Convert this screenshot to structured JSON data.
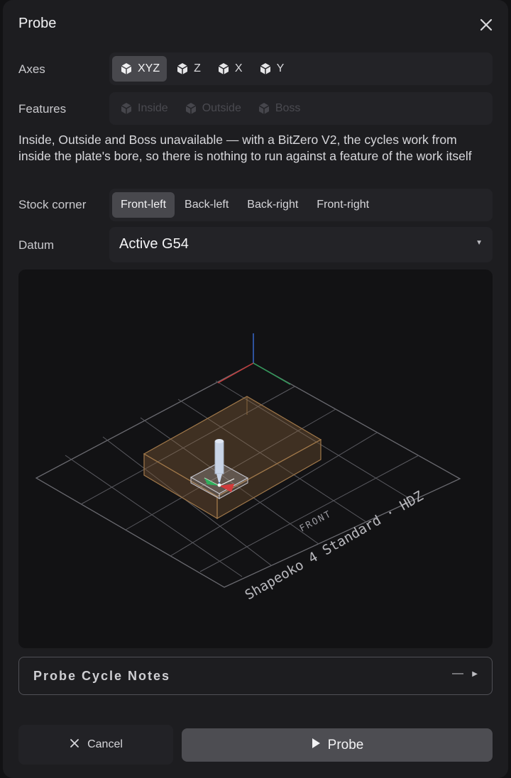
{
  "dialog": {
    "title": "Probe"
  },
  "axes": {
    "label": "Axes",
    "options": [
      "XYZ",
      "Z",
      "X",
      "Y"
    ],
    "selected": "XYZ"
  },
  "features": {
    "label": "Features",
    "options": [
      "Inside",
      "Outside",
      "Boss"
    ]
  },
  "notice": "Inside, Outside and Boss unavailable — with a BitZero V2, the cycles work from inside the plate's bore, so there is nothing to run against a feature of the work itself",
  "stock_corner": {
    "label": "Stock corner",
    "options": [
      "Front-left",
      "Back-left",
      "Back-right",
      "Front-right"
    ],
    "selected": "Front-left"
  },
  "datum": {
    "label": "Datum",
    "value": "Active G54"
  },
  "viewport": {
    "front_label": "FRONT",
    "machine_label": "Shapeoko 4 Standard · HDZ"
  },
  "notes": {
    "title": "Probe Cycle Notes",
    "collapsed_indicator": "—"
  },
  "actions": {
    "cancel_label": "Cancel",
    "probe_label": "Probe"
  }
}
